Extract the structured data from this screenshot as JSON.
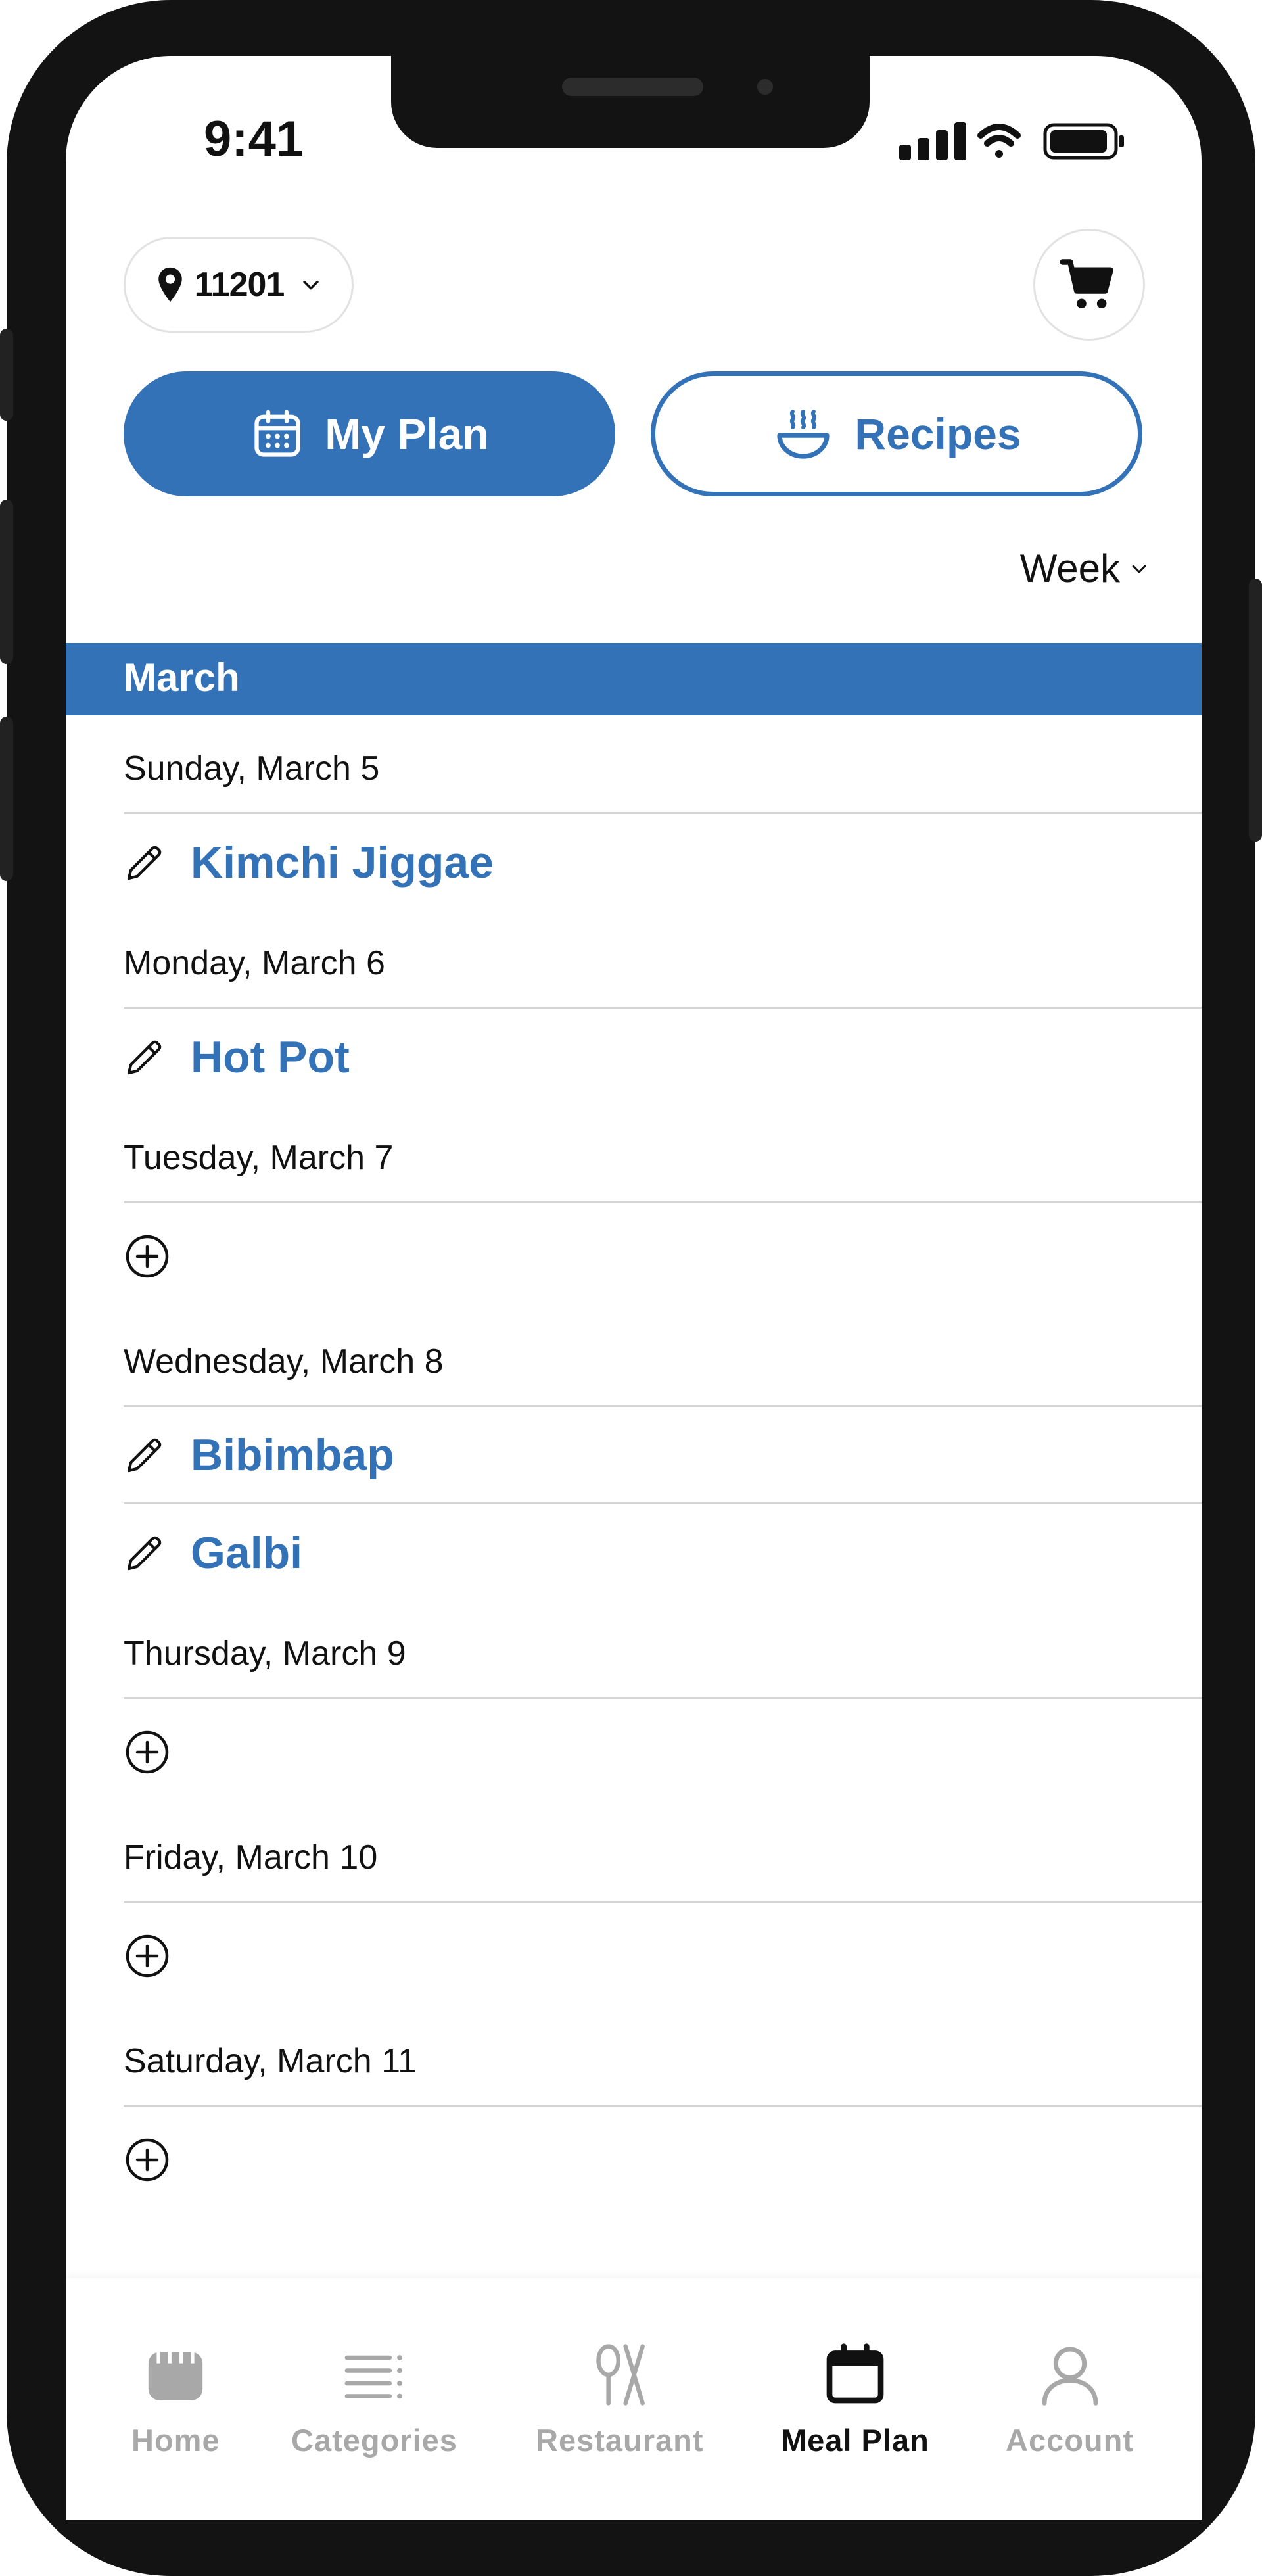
{
  "status_bar": {
    "time": "9:41"
  },
  "header": {
    "location": {
      "zip": "11201",
      "icon": "map-pin-icon",
      "chevron": "chevron-down-icon"
    },
    "cart_icon": "shopping-cart-icon"
  },
  "segmented": {
    "my_plan": {
      "label": "My Plan",
      "icon": "calendar-icon"
    },
    "recipes": {
      "label": "Recipes",
      "icon": "steaming-bowl-icon"
    }
  },
  "view_selector": {
    "label": "Week",
    "icon": "chevron-down-icon"
  },
  "month": "March",
  "days": [
    {
      "date": "Sunday, March 5",
      "meals": [
        "Kimchi Jiggae"
      ]
    },
    {
      "date": "Monday, March 6",
      "meals": [
        "Hot Pot"
      ]
    },
    {
      "date": "Tuesday, March 7",
      "meals": []
    },
    {
      "date": "Wednesday, March 8",
      "meals": [
        "Bibimbap",
        "Galbi"
      ]
    },
    {
      "date": "Thursday, March 9",
      "meals": []
    },
    {
      "date": "Friday, March 10",
      "meals": []
    },
    {
      "date": "Saturday, March 11",
      "meals": []
    }
  ],
  "tabs": [
    {
      "label": "Home",
      "icon": "home-icon",
      "active": false
    },
    {
      "label": "Categories",
      "icon": "list-icon",
      "active": false
    },
    {
      "label": "Restaurant",
      "icon": "utensils-icon",
      "active": false
    },
    {
      "label": "Meal Plan",
      "icon": "calendar-icon",
      "active": true
    },
    {
      "label": "Account",
      "icon": "user-icon",
      "active": false
    }
  ],
  "colors": {
    "primary": "#3372b6",
    "text": "#111111",
    "muted": "#a8a8a8",
    "divider": "#d4d4d4"
  }
}
